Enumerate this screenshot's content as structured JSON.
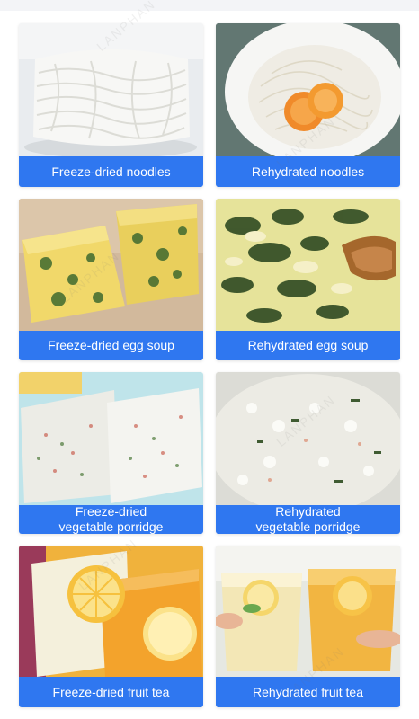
{
  "watermark": "LANPHAN",
  "accent_color": "#2f77f0",
  "cards": [
    {
      "caption_lines": [
        "Freeze-dried noodles"
      ],
      "image": "freeze-dried-noodles-photo"
    },
    {
      "caption_lines": [
        "Rehydrated noodles"
      ],
      "image": "rehydrated-noodles-photo"
    },
    {
      "caption_lines": [
        "Freeze-dried egg soup"
      ],
      "image": "freeze-dried-egg-soup-photo"
    },
    {
      "caption_lines": [
        "Rehydrated egg soup"
      ],
      "image": "rehydrated-egg-soup-photo"
    },
    {
      "caption_lines": [
        "Freeze-dried",
        "vegetable porridge"
      ],
      "image": "freeze-dried-porridge-photo"
    },
    {
      "caption_lines": [
        "Rehydrated",
        "vegetable porridge"
      ],
      "image": "rehydrated-porridge-photo"
    },
    {
      "caption_lines": [
        "Freeze-dried fruit tea"
      ],
      "image": "freeze-dried-fruit-tea-photo"
    },
    {
      "caption_lines": [
        "Rehydrated fruit tea"
      ],
      "image": "rehydrated-fruit-tea-photo"
    }
  ]
}
